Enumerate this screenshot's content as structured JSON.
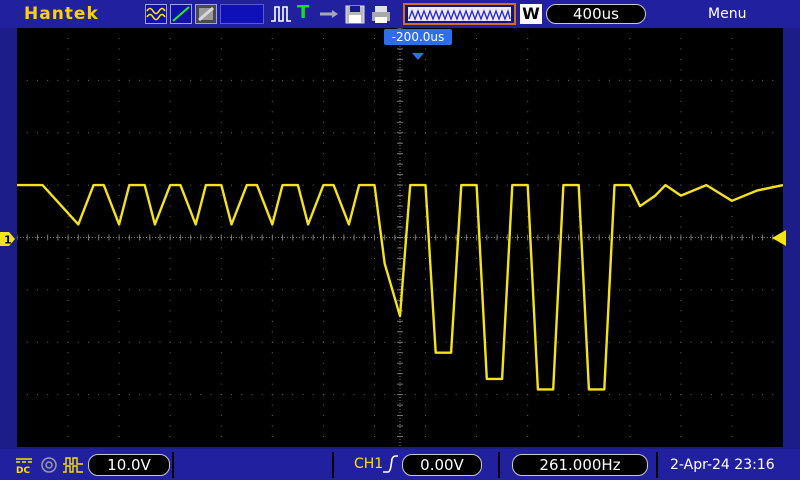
{
  "header": {
    "brand": "Hantek",
    "timebase": "400us",
    "mode_letter": "W",
    "menu_label": "Menu",
    "trigger_offset": "-200.0us",
    "icons": [
      "wave-icon",
      "slope-icon",
      "persistence-icon",
      "pulse-icon",
      "trigger-t-icon",
      "arrow-icon",
      "save-icon",
      "print-icon"
    ]
  },
  "footer": {
    "volts_div": "10.0V",
    "trigger_source": "CH1",
    "trigger_level": "0.00V",
    "frequency": "261.000Hz",
    "datetime": "2-Apr-24 23:16"
  },
  "channel": {
    "marker": "1",
    "color": "#f5e31a"
  },
  "chart_data": {
    "type": "line",
    "series": [
      {
        "x": [
          0,
          0.5,
          1.2,
          1.5,
          1.7,
          2.0,
          2.2,
          2.5,
          2.7,
          3.0,
          3.2,
          3.5,
          3.7,
          4.0,
          4.2,
          4.5,
          4.7,
          5.0,
          5.2,
          5.5,
          5.7,
          6.0,
          6.2,
          6.5,
          6.7,
          7.0,
          7.2,
          7.5,
          7.7,
          8.0,
          8.2,
          8.5,
          8.7,
          9.0,
          9.2,
          9.5,
          9.7,
          10.0,
          10.2,
          10.5,
          10.7,
          11.0,
          11.2,
          11.5,
          11.7,
          12.0,
          12.2,
          12.5,
          12.7,
          13.0,
          13.5,
          14.0,
          14.5,
          15.0
        ],
        "values": [
          1.0,
          1.0,
          0.25,
          1.0,
          1.0,
          0.25,
          1.0,
          1.0,
          0.25,
          1.0,
          1.0,
          0.25,
          1.0,
          1.0,
          0.25,
          1.0,
          1.0,
          0.25,
          1.0,
          1.0,
          0.25,
          1.0,
          1.0,
          0.25,
          1.0,
          1.0,
          -0.5,
          -1.5,
          1.0,
          1.0,
          -2.2,
          -2.2,
          1.0,
          1.0,
          -2.7,
          -2.7,
          1.0,
          1.0,
          -2.9,
          -2.9,
          1.0,
          1.0,
          -2.9,
          -2.9,
          1.0,
          1.0,
          0.6,
          0.8,
          1.0,
          0.8,
          1.0,
          0.7,
          0.9,
          1.0
        ]
      }
    ],
    "xlim": [
      0,
      15
    ],
    "ylim": [
      -4,
      4
    ],
    "grid": true
  }
}
